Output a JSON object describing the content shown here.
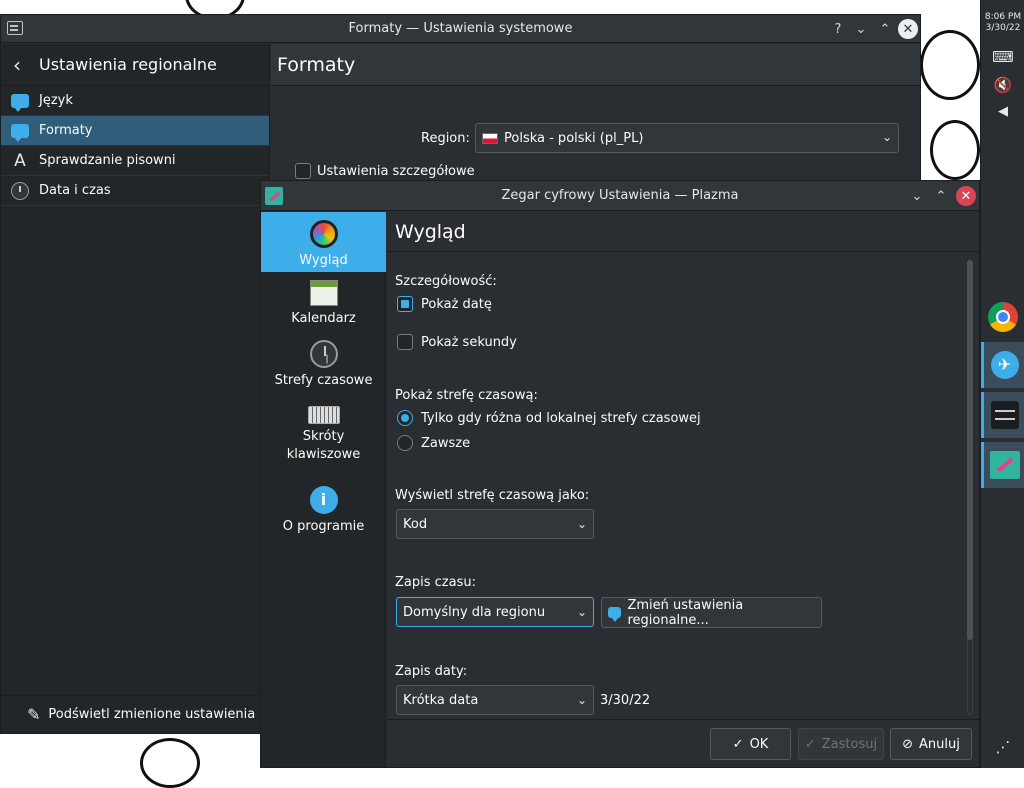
{
  "system_settings": {
    "title": "Formaty — Ustawienia systemowe",
    "help": "?",
    "minimize": "⌄",
    "maximize": "⌃",
    "close": "✕",
    "sidebar_heading": "Ustawienia regionalne",
    "sidebar_items": [
      {
        "label": "Język",
        "icon": "chat-icon"
      },
      {
        "label": "Formaty",
        "icon": "chat-icon"
      },
      {
        "label": "Sprawdzanie pisowni",
        "icon": "letter-a-icon"
      },
      {
        "label": "Data i czas",
        "icon": "clock-icon"
      }
    ],
    "highlight_changes": "Podświetl zmienione ustawienia",
    "page_title": "Formaty",
    "region_label": "Region:",
    "region_value": "Polska - polski (pl_PL)",
    "detailed_settings": "Ustawienia szczegółowe"
  },
  "clock_dialog": {
    "title": "Zegar cyfrowy Ustawienia — Plazma",
    "minimize": "⌄",
    "maximize": "⌃",
    "close": "✕",
    "sidebar": [
      {
        "label": "Wygląd",
        "icon": "appearance-icon"
      },
      {
        "label": "Kalendarz",
        "icon": "calendar-icon"
      },
      {
        "label": "Strefy czasowe",
        "icon": "clock-icon"
      },
      {
        "label": "Skróty klawiszowe",
        "icon": "keyboard-icon"
      },
      {
        "label": "O programie",
        "icon": "info-icon"
      }
    ],
    "heading": "Wygląd",
    "detail_label": "Szczegółowość:",
    "show_date": "Pokaż datę",
    "show_seconds": "Pokaż sekundy",
    "show_timezone_label": "Pokaż strefę czasową:",
    "tz_only_different": "Tylko gdy różna od lokalnej strefy czasowej",
    "tz_always": "Zawsze",
    "display_tz_as_label": "Wyświetl strefę czasową jako:",
    "display_tz_as_value": "Kod",
    "time_format_label": "Zapis czasu:",
    "time_format_value": "Domyślny dla regionu",
    "change_regional": "Zmień ustawienia regionalne...",
    "date_format_label": "Zapis daty:",
    "date_format_value": "Krótka data",
    "date_preview": "3/30/22",
    "ok": "OK",
    "apply": "Zastosuj",
    "cancel": "Anuluj"
  },
  "panel": {
    "time": "8:06 PM",
    "date": "3/30/22"
  },
  "colors": {
    "accent": "#3daee9",
    "window_bg": "#2a2e32",
    "close_red": "#da4453"
  }
}
